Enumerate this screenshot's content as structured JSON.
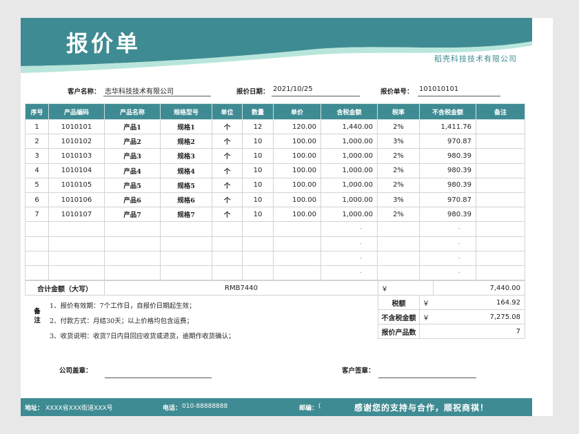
{
  "header": {
    "title": "报价单",
    "company": "稻壳科技技术有限公司",
    "colors": {
      "primary": "#3f8b93",
      "wave_light": "#b9e6db"
    }
  },
  "info": {
    "customer_label": "客户名称：",
    "customer_value": "志华科技技术有限公司",
    "date_label": "报价日期：",
    "date_value": "2021/10/25",
    "quote_no_label": "报价单号：",
    "quote_no_value": "101010101"
  },
  "table": {
    "headers": [
      "序号",
      "产品编码",
      "产品名称",
      "规格型号",
      "单位",
      "数量",
      "单价",
      "含税金额",
      "税率",
      "不含税金额",
      "备注"
    ],
    "rows": [
      [
        "1",
        "1010101",
        "产品1",
        "规格1",
        "个",
        "12",
        "120.00",
        "1,440.00",
        "2%",
        "1,411.76",
        ""
      ],
      [
        "2",
        "1010102",
        "产品2",
        "规格2",
        "个",
        "10",
        "100.00",
        "1,000.00",
        "3%",
        "970.87",
        ""
      ],
      [
        "3",
        "1010103",
        "产品3",
        "规格3",
        "个",
        "10",
        "100.00",
        "1,000.00",
        "2%",
        "980.39",
        ""
      ],
      [
        "4",
        "1010104",
        "产品4",
        "规格4",
        "个",
        "10",
        "100.00",
        "1,000.00",
        "2%",
        "980.39",
        ""
      ],
      [
        "5",
        "1010105",
        "产品5",
        "规格5",
        "个",
        "10",
        "100.00",
        "1,000.00",
        "2%",
        "980.39",
        ""
      ],
      [
        "6",
        "1010106",
        "产品6",
        "规格6",
        "个",
        "10",
        "100.00",
        "1,000.00",
        "3%",
        "970.87",
        ""
      ],
      [
        "7",
        "1010107",
        "产品7",
        "规格7",
        "个",
        "10",
        "100.00",
        "1,000.00",
        "2%",
        "980.39",
        ""
      ],
      [
        "",
        "",
        "",
        "",
        "",
        "",
        "",
        "-",
        "",
        "-",
        ""
      ],
      [
        "",
        "",
        "",
        "",
        "",
        "",
        "",
        "-",
        "",
        "-",
        ""
      ],
      [
        "",
        "",
        "",
        "",
        "",
        "",
        "",
        "-",
        "",
        "-",
        ""
      ],
      [
        "",
        "",
        "",
        "",
        "",
        "",
        "",
        "-",
        "",
        "-",
        ""
      ]
    ]
  },
  "summary": {
    "total_label": "合计金额（大写）",
    "total_words": "RMB7440",
    "currency_symbol": "￥",
    "total_amount": "7,440.00",
    "tax_label": "税额",
    "tax_amount": "164.92",
    "pretax_label": "不含税金额",
    "pretax_amount": "7,275.08",
    "count_label": "报价产品数",
    "count_value": "7"
  },
  "notes": {
    "label": "备注",
    "items": [
      "1、报价有效期：7个工作日，自报价日期起生效；",
      "2、付款方式：月结30天；以上价格均包含运费；",
      "3、收货说明：收货7日内目回应收货或退货，逾期作收货确认；"
    ]
  },
  "signatures": {
    "company_label": "公司盖章：",
    "customer_label": "客户签章："
  },
  "footer": {
    "address_label": "地址：",
    "address_value": "XXXX省XXX街道XXX号",
    "phone_label": "电话：",
    "phone_value": "010-88888888",
    "postcode_label": "邮编：",
    "postcode_value": "(",
    "thanks": "感谢您的支持与合作，顺祝商祺！"
  }
}
